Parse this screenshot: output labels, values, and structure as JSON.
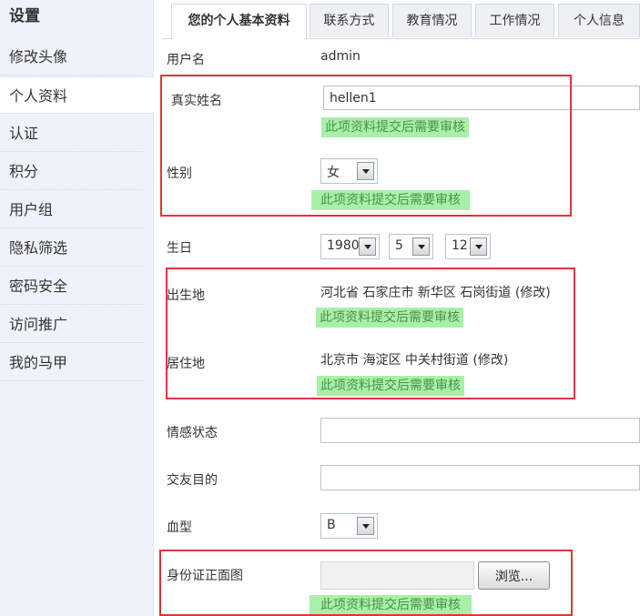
{
  "sidebar": {
    "heading": "设置",
    "items": [
      {
        "label": "修改头像"
      },
      {
        "label": "个人资料"
      },
      {
        "label": "认证"
      },
      {
        "label": "积分"
      },
      {
        "label": "用户组"
      },
      {
        "label": "隐私筛选"
      },
      {
        "label": "密码安全"
      },
      {
        "label": "访问推广"
      },
      {
        "label": "我的马甲"
      }
    ]
  },
  "tabs": [
    "您的个人基本资料",
    "联系方式",
    "教育情况",
    "工作情况",
    "个人信息"
  ],
  "form": {
    "username": {
      "label": "用户名",
      "value": "admin"
    },
    "realname": {
      "label": "真实姓名",
      "value": "hellen1"
    },
    "gender": {
      "label": "性别",
      "value": "女"
    },
    "birthday": {
      "label": "生日",
      "year": "1980",
      "month": "5",
      "day": "12"
    },
    "birthplace": {
      "label": "出生地",
      "value": "河北省 石家庄市 新华区 石岗街道",
      "action": "(修改)"
    },
    "residence": {
      "label": "居住地",
      "value": "北京市 海淀区 中关村街道",
      "action": "(修改)"
    },
    "emotion": {
      "label": "情感状态",
      "value": ""
    },
    "purpose": {
      "label": "交友目的",
      "value": ""
    },
    "bloodtype": {
      "label": "血型",
      "value": "B"
    },
    "idcard": {
      "label": "身份证正面图",
      "browse": "浏览..."
    }
  },
  "notice_text": "此项资料提交后需要审核",
  "colors": {
    "notice_bg": "#a8f0a8",
    "highlight_border": "#e0343a",
    "sidebar_bg": "#eef3f9"
  }
}
